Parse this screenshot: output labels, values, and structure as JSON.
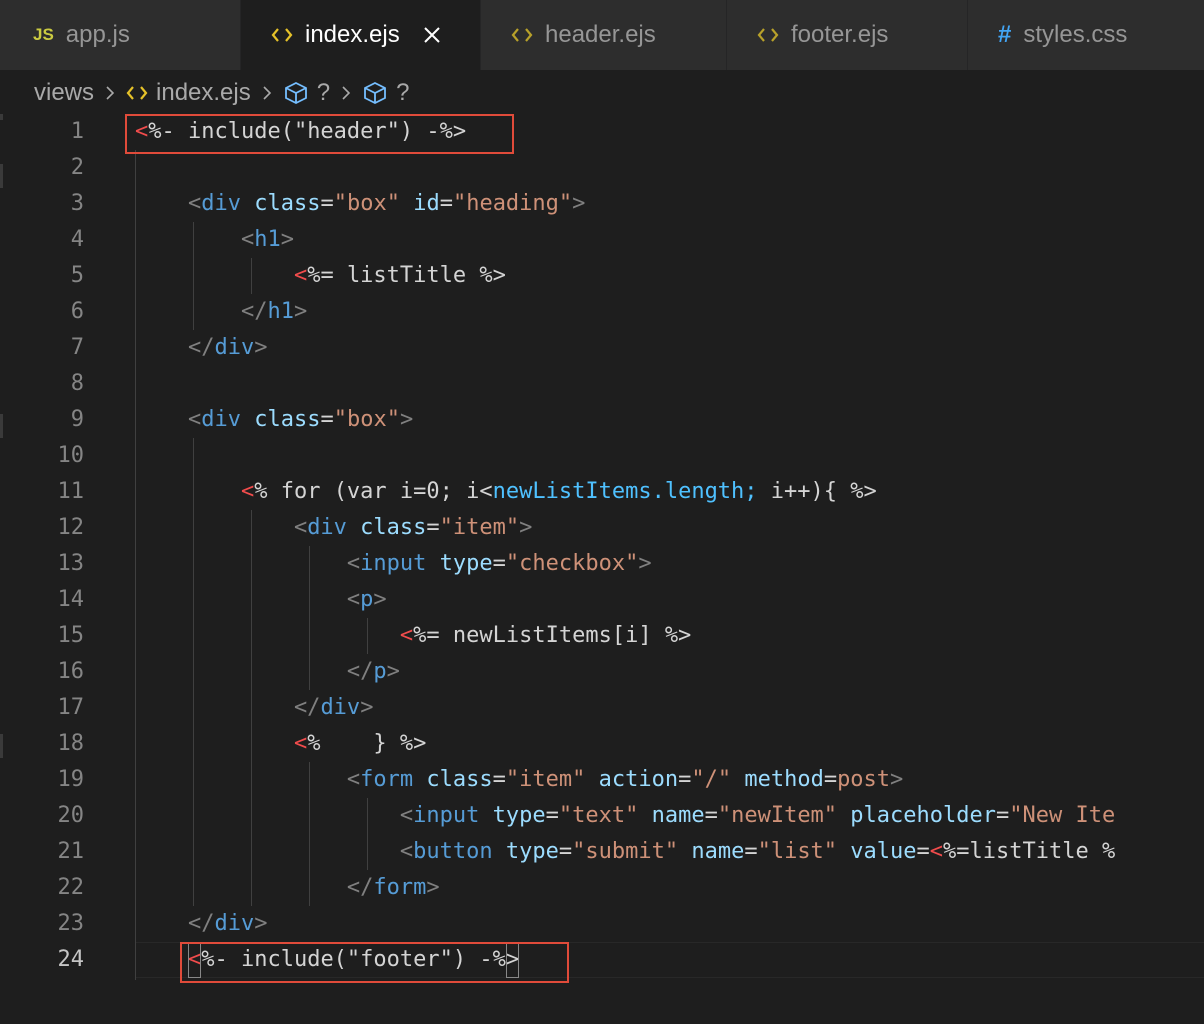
{
  "tabs": [
    {
      "label": "app.js",
      "icon": "js-file-icon",
      "icon_text": "JS",
      "active": false
    },
    {
      "label": "index.ejs",
      "icon": "html-file-icon",
      "active": true
    },
    {
      "label": "header.ejs",
      "icon": "html-file-icon",
      "active": false
    },
    {
      "label": "footer.ejs",
      "icon": "html-file-icon",
      "active": false
    },
    {
      "label": "styles.css",
      "icon": "css-file-icon",
      "icon_text": "#",
      "active": false
    }
  ],
  "breadcrumb": {
    "folder": "views",
    "file": "index.ejs",
    "symbol1": "?",
    "symbol2": "?"
  },
  "editor": {
    "current_line": 24,
    "lines": [
      {
        "n": "1",
        "tokens": [
          [
            "<",
            "t-red"
          ],
          [
            "%- include(\"header\") -%>",
            "t-kw"
          ]
        ]
      },
      {
        "n": "2",
        "tokens": []
      },
      {
        "n": "3",
        "tokens": [
          [
            "    <",
            "t-br"
          ],
          [
            "div",
            "t-tag"
          ],
          [
            " class",
            "t-attr"
          ],
          [
            "=",
            "t-kw"
          ],
          [
            "\"box\"",
            "t-str"
          ],
          [
            " id",
            "t-attr"
          ],
          [
            "=",
            "t-kw"
          ],
          [
            "\"heading\"",
            "t-str"
          ],
          [
            ">",
            "t-br"
          ]
        ]
      },
      {
        "n": "4",
        "tokens": [
          [
            "        <",
            "t-br"
          ],
          [
            "h1",
            "t-tag"
          ],
          [
            ">",
            "t-br"
          ]
        ]
      },
      {
        "n": "5",
        "tokens": [
          [
            "            ",
            "t-kw"
          ],
          [
            "<",
            "t-red"
          ],
          [
            "%= listTitle %>",
            "t-kw"
          ]
        ]
      },
      {
        "n": "6",
        "tokens": [
          [
            "        </",
            "t-br"
          ],
          [
            "h1",
            "t-tag"
          ],
          [
            ">",
            "t-br"
          ]
        ]
      },
      {
        "n": "7",
        "tokens": [
          [
            "    </",
            "t-br"
          ],
          [
            "div",
            "t-tag"
          ],
          [
            ">",
            "t-br"
          ]
        ]
      },
      {
        "n": "8",
        "tokens": []
      },
      {
        "n": "9",
        "tokens": [
          [
            "    <",
            "t-br"
          ],
          [
            "div",
            "t-tag"
          ],
          [
            " class",
            "t-attr"
          ],
          [
            "=",
            "t-kw"
          ],
          [
            "\"box\"",
            "t-str"
          ],
          [
            ">",
            "t-br"
          ]
        ]
      },
      {
        "n": "10",
        "tokens": []
      },
      {
        "n": "11",
        "tokens": [
          [
            "        ",
            "t-kw"
          ],
          [
            "<",
            "t-red"
          ],
          [
            "% for (var i=0; i<",
            "t-kw"
          ],
          [
            "newListItems.length;",
            "t-var"
          ],
          [
            " i++){ %>",
            "t-kw"
          ]
        ]
      },
      {
        "n": "12",
        "tokens": [
          [
            "            <",
            "t-br"
          ],
          [
            "div",
            "t-tag"
          ],
          [
            " class",
            "t-attr"
          ],
          [
            "=",
            "t-kw"
          ],
          [
            "\"item\"",
            "t-str"
          ],
          [
            ">",
            "t-br"
          ]
        ]
      },
      {
        "n": "13",
        "tokens": [
          [
            "                <",
            "t-br"
          ],
          [
            "input",
            "t-tag"
          ],
          [
            " type",
            "t-attr"
          ],
          [
            "=",
            "t-kw"
          ],
          [
            "\"checkbox\"",
            "t-str"
          ],
          [
            ">",
            "t-br"
          ]
        ]
      },
      {
        "n": "14",
        "tokens": [
          [
            "                <",
            "t-br"
          ],
          [
            "p",
            "t-tag"
          ],
          [
            ">",
            "t-br"
          ]
        ]
      },
      {
        "n": "15",
        "tokens": [
          [
            "                    ",
            "t-kw"
          ],
          [
            "<",
            "t-red"
          ],
          [
            "%= newListItems[i] %>",
            "t-kw"
          ]
        ]
      },
      {
        "n": "16",
        "tokens": [
          [
            "                </",
            "t-br"
          ],
          [
            "p",
            "t-tag"
          ],
          [
            ">",
            "t-br"
          ]
        ]
      },
      {
        "n": "17",
        "tokens": [
          [
            "            </",
            "t-br"
          ],
          [
            "div",
            "t-tag"
          ],
          [
            ">",
            "t-br"
          ]
        ]
      },
      {
        "n": "18",
        "tokens": [
          [
            "            ",
            "t-kw"
          ],
          [
            "<",
            "t-red"
          ],
          [
            "%    } %>",
            "t-kw"
          ]
        ]
      },
      {
        "n": "19",
        "tokens": [
          [
            "                <",
            "t-br"
          ],
          [
            "form",
            "t-tag"
          ],
          [
            " class",
            "t-attr"
          ],
          [
            "=",
            "t-kw"
          ],
          [
            "\"item\"",
            "t-str"
          ],
          [
            " action",
            "t-attr"
          ],
          [
            "=",
            "t-kw"
          ],
          [
            "\"/\"",
            "t-str"
          ],
          [
            " method",
            "t-attr"
          ],
          [
            "=",
            "t-kw"
          ],
          [
            "post",
            "t-str"
          ],
          [
            ">",
            "t-br"
          ]
        ]
      },
      {
        "n": "20",
        "tokens": [
          [
            "                    <",
            "t-br"
          ],
          [
            "input",
            "t-tag"
          ],
          [
            " type",
            "t-attr"
          ],
          [
            "=",
            "t-kw"
          ],
          [
            "\"text\"",
            "t-str"
          ],
          [
            " name",
            "t-attr"
          ],
          [
            "=",
            "t-kw"
          ],
          [
            "\"newItem\"",
            "t-str"
          ],
          [
            " placeholder",
            "t-attr"
          ],
          [
            "=",
            "t-kw"
          ],
          [
            "\"New Ite",
            "t-str"
          ]
        ]
      },
      {
        "n": "21",
        "tokens": [
          [
            "                    <",
            "t-br"
          ],
          [
            "button",
            "t-tag"
          ],
          [
            " type",
            "t-attr"
          ],
          [
            "=",
            "t-kw"
          ],
          [
            "\"submit\"",
            "t-str"
          ],
          [
            " name",
            "t-attr"
          ],
          [
            "=",
            "t-kw"
          ],
          [
            "\"list\"",
            "t-str"
          ],
          [
            " value",
            "t-attr"
          ],
          [
            "=",
            "t-kw"
          ],
          [
            "<",
            "t-red"
          ],
          [
            "%=listTitle %",
            "t-kw"
          ]
        ]
      },
      {
        "n": "22",
        "tokens": [
          [
            "                </",
            "t-br"
          ],
          [
            "form",
            "t-tag"
          ],
          [
            ">",
            "t-br"
          ]
        ]
      },
      {
        "n": "23",
        "tokens": [
          [
            "    </",
            "t-br"
          ],
          [
            "div",
            "t-tag"
          ],
          [
            ">",
            "t-br"
          ]
        ]
      },
      {
        "n": "24",
        "tokens": [
          [
            "    ",
            "t-kw"
          ],
          [
            "<",
            "t-red"
          ],
          [
            "%- include(\"footer\") -%",
            "t-kw"
          ],
          [
            ">",
            "t-kw"
          ]
        ]
      }
    ]
  }
}
